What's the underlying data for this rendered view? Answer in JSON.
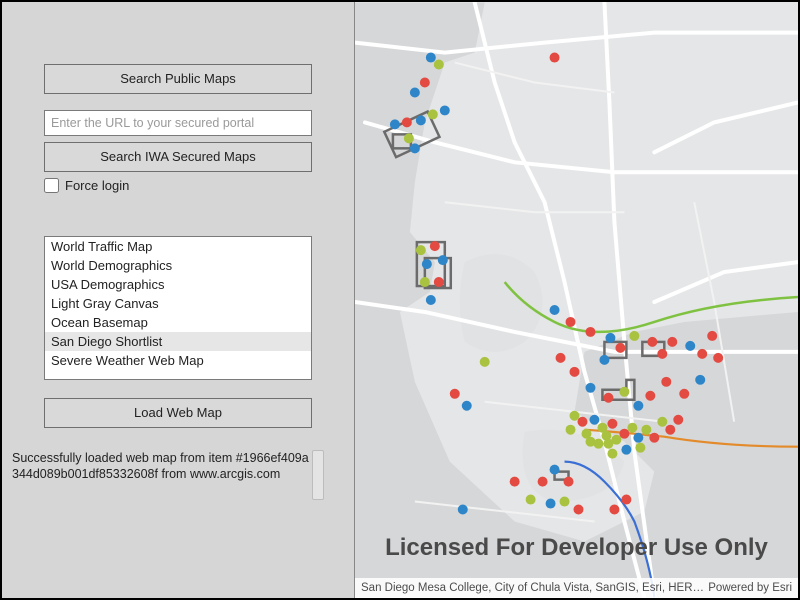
{
  "sidebar": {
    "search_public_label": "Search Public Maps",
    "url_placeholder": "Enter the URL to your secured portal",
    "search_iwa_label": "Search IWA Secured Maps",
    "force_login_label": "Force login",
    "force_login_checked": false,
    "load_label": "Load Web Map",
    "list_items": [
      "World Traffic Map",
      "World Demographics",
      "USA Demographics",
      "Light Gray Canvas",
      "Ocean Basemap",
      "San Diego Shortlist",
      "Severe Weather Web Map"
    ],
    "selected_index": 5,
    "status_prefix": "Successfully loaded web map from item ",
    "status_item": "#1966ef409a344d089b001df85332608f",
    "status_from": " from ",
    "status_host": "www.arcgis.com"
  },
  "map": {
    "watermark": "Licensed For Developer Use Only",
    "attribution_left": "San Diego Mesa College, City of Chula Vista, SanGIS, Esri, HERE,…",
    "attribution_right": "Powered by Esri",
    "colors": {
      "land": "#dedfe0",
      "coast": "#c7c8c9",
      "water": "#dfe0e1",
      "road_major": "#ffffff",
      "road_minor": "#f3f3f3",
      "poi_red": "#e34a42",
      "poi_blue": "#2e86c9",
      "poi_green": "#a9c23f",
      "route_green": "#7fc241",
      "route_orange": "#e38a2a",
      "route_blue": "#3a6fd6",
      "frame": "#6b6b6b"
    }
  }
}
